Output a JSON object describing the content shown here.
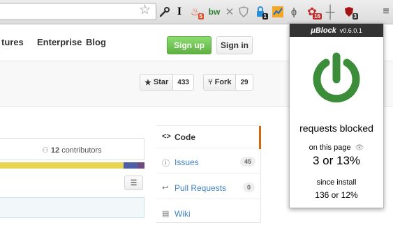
{
  "header_nav": {
    "items": [
      "tures",
      "Enterprise",
      "Blog"
    ],
    "signup": "Sign up",
    "signin": "Sign in"
  },
  "repo_actions": {
    "star_label": "Star",
    "star_count": "433",
    "fork_label": "Fork",
    "fork_count": "29"
  },
  "summary": {
    "contributors_count": "12",
    "contributors_label": "contributors"
  },
  "sidebar": {
    "items": [
      {
        "icon": "<>",
        "label": "Code",
        "count": ""
      },
      {
        "icon": "ⓘ",
        "label": "Issues",
        "count": "45"
      },
      {
        "icon": "↩",
        "label": "Pull Requests",
        "count": "0"
      },
      {
        "icon": "▤",
        "label": "Wiki",
        "count": ""
      }
    ]
  },
  "extensions": {
    "badges": [
      "5",
      "1",
      "16",
      "3"
    ]
  },
  "popup": {
    "name": "μBlock",
    "version": "v0.6.0.1",
    "requests_blocked": "requests blocked",
    "on_this_page_label": "on this page",
    "on_this_page_value": "3 or 13%",
    "since_install_label": "since install",
    "since_install_value": "136 or 12%",
    "power_color": "#2e7d32"
  },
  "colors": {
    "signup_green": "#60b044",
    "lang_yellow": "#e8d553",
    "lang_blue": "#4c5fa6"
  }
}
